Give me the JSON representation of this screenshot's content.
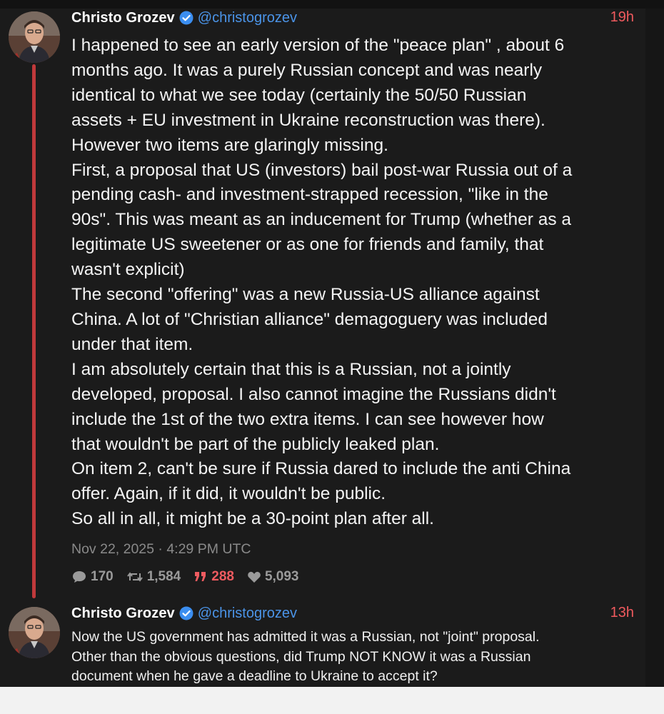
{
  "posts": [
    {
      "author": "Christo Grozev",
      "handle": "@christogrozev",
      "time": "19h",
      "paragraphs": [
        "I happened to see an early version of the \"peace plan\" , about 6",
        "months ago. It was a purely Russian concept and was nearly",
        "identical to what we see today (certainly the 50/50 Russian",
        "assets + EU investment in Ukraine reconstruction was there).",
        "However two items are glaringly missing.",
        "First, a proposal that US (investors) bail post-war Russia out of a",
        "pending cash- and investment-strapped recession, \"like in the",
        "90s\". This was meant as an inducement for Trump (whether as a",
        "legitimate US sweetener or as one for friends and family, that",
        "wasn't explicit)",
        "The second \"offering\" was a new Russia-US alliance against",
        "China.  A lot of \"Christian alliance\" demagoguery was included",
        "under that item.",
        "I am absolutely certain that this is a Russian, not a jointly",
        "developed, proposal. I also cannot imagine the Russians didn't",
        "include the 1st of the two extra items. I can see however how",
        "that wouldn't be part of the publicly leaked plan.",
        "On item 2, can't be sure if Russia dared to include the anti China",
        "offer. Again, if it did, it wouldn't be public.",
        "So all in all, it might be a 30-point plan after all."
      ],
      "timestamp": "Nov 22, 2025 · 4:29 PM UTC",
      "stats": {
        "replies": "170",
        "reposts": "1,584",
        "quotes": "288",
        "likes": "5,093"
      }
    },
    {
      "author": "Christo Grozev",
      "handle": "@christogrozev",
      "time": "13h",
      "paragraphs": [
        "Now the US government has admitted it was a Russian, not \"joint\" proposal.",
        "Other than the obvious questions, did Trump NOT KNOW it was a Russian",
        "document when he gave a deadline to Ukraine to accept it?"
      ]
    }
  ],
  "icons": {
    "verified": "verified-badge-icon",
    "reply": "speech-bubble-icon",
    "repost": "repost-arrows-icon",
    "quote": "quote-marks-icon",
    "like": "heart-icon"
  },
  "colors": {
    "background": "#1b1b1b",
    "accent_red": "#f05a5e",
    "handle_blue": "#4b94e8",
    "thread_line": "#c0393b"
  }
}
